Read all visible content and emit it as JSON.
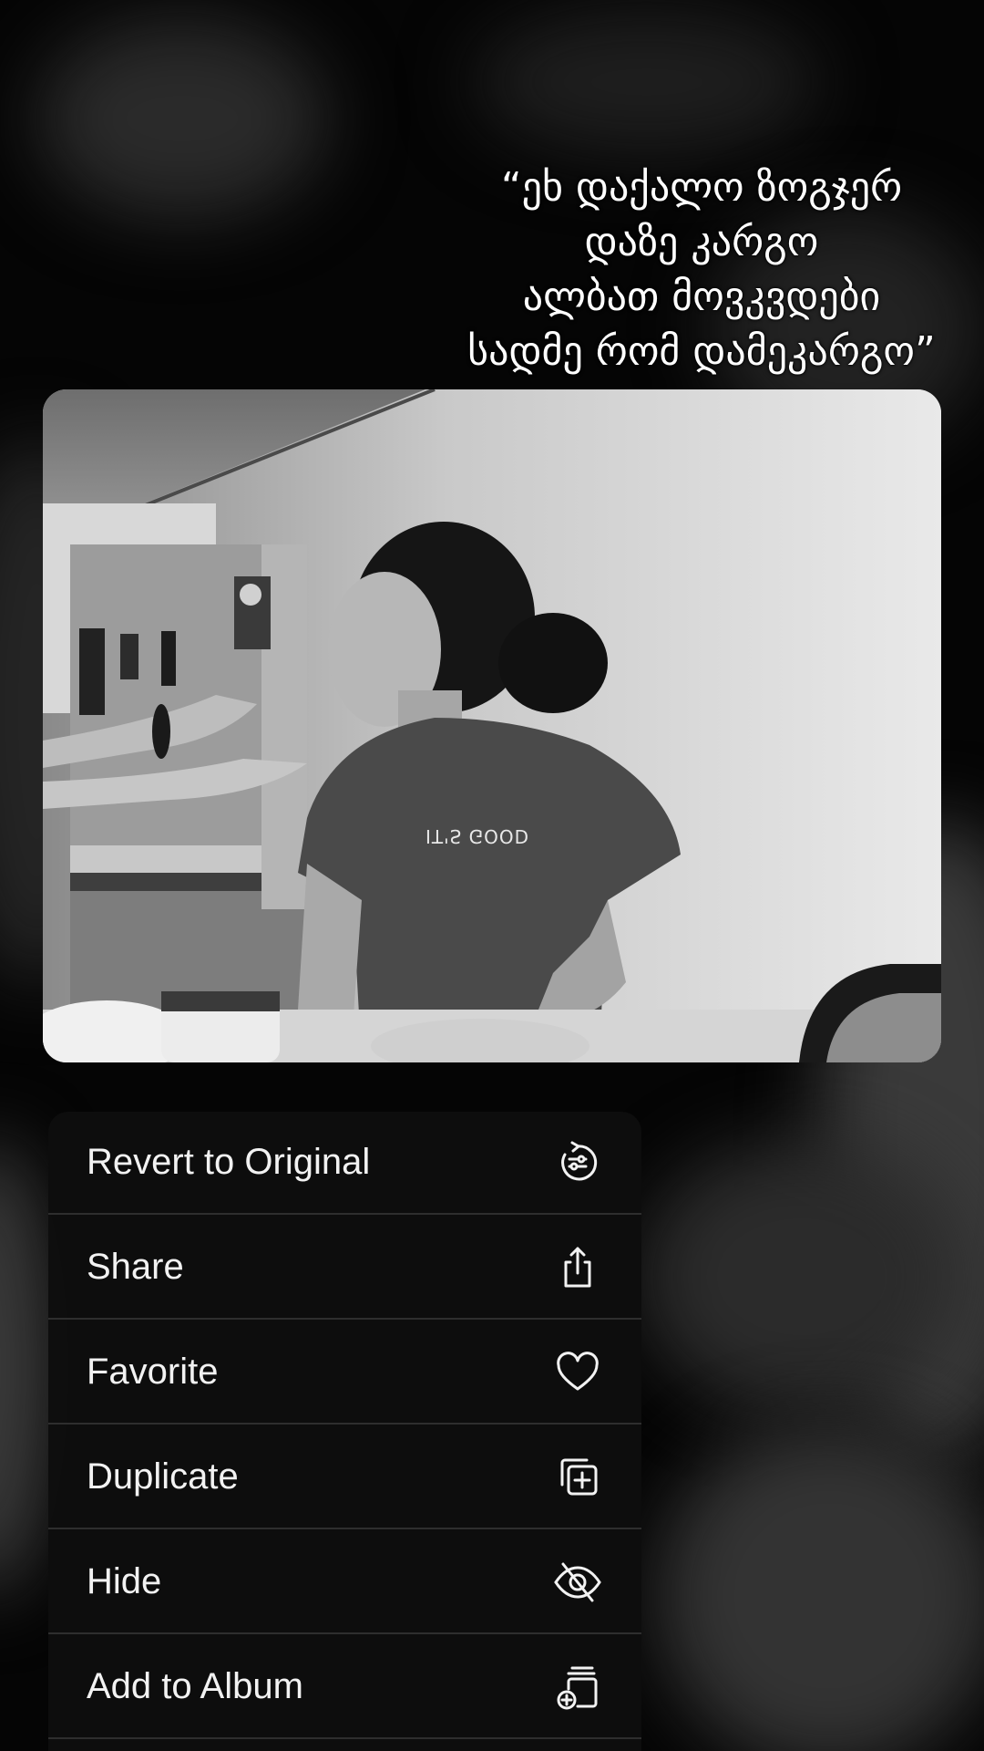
{
  "quote": {
    "lines": [
      "“ეხ დაქალო ზოგჯერ",
      "დაზე კარგო",
      "ალბათ მოვკვდები",
      "სადმე რომ დამეკარგო”"
    ]
  },
  "photo": {
    "tshirt_text": "IT'S GOOD"
  },
  "menu": {
    "items": [
      {
        "label": "Revert to Original",
        "icon": "revert-icon"
      },
      {
        "label": "Share",
        "icon": "share-icon"
      },
      {
        "label": "Favorite",
        "icon": "heart-icon"
      },
      {
        "label": "Duplicate",
        "icon": "duplicate-icon"
      },
      {
        "label": "Hide",
        "icon": "eye-slash-icon"
      },
      {
        "label": "Add to Album",
        "icon": "add-to-album-icon"
      }
    ]
  }
}
